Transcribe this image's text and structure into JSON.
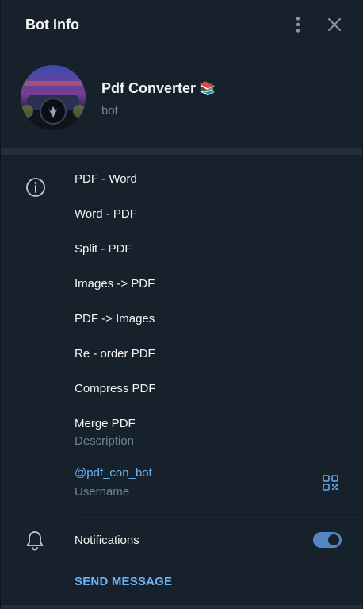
{
  "header": {
    "title": "Bot Info",
    "more_icon": "vertical-dots-icon",
    "close_icon": "close-icon"
  },
  "profile": {
    "name": "Pdf Converter",
    "name_emoji": "📚",
    "status": "bot"
  },
  "description": {
    "lines": [
      "PDF - Word",
      "Word - PDF",
      "Split - PDF",
      "Images -> PDF",
      "PDF -> Images",
      "Re - order PDF",
      "Compress PDF",
      "Merge PDF"
    ],
    "caption": "Description",
    "icon": "info-icon"
  },
  "username": {
    "value": "@pdf_con_bot",
    "caption": "Username",
    "qr_icon": "qr-code-icon"
  },
  "notifications": {
    "label": "Notifications",
    "enabled": true,
    "icon": "bell-icon"
  },
  "actions": {
    "send_message": "SEND MESSAGE"
  },
  "colors": {
    "background": "#17212b",
    "accent": "#6ab3f3",
    "toggle": "#5288c1",
    "secondary_text": "#708499",
    "separator": "#232e3c"
  }
}
